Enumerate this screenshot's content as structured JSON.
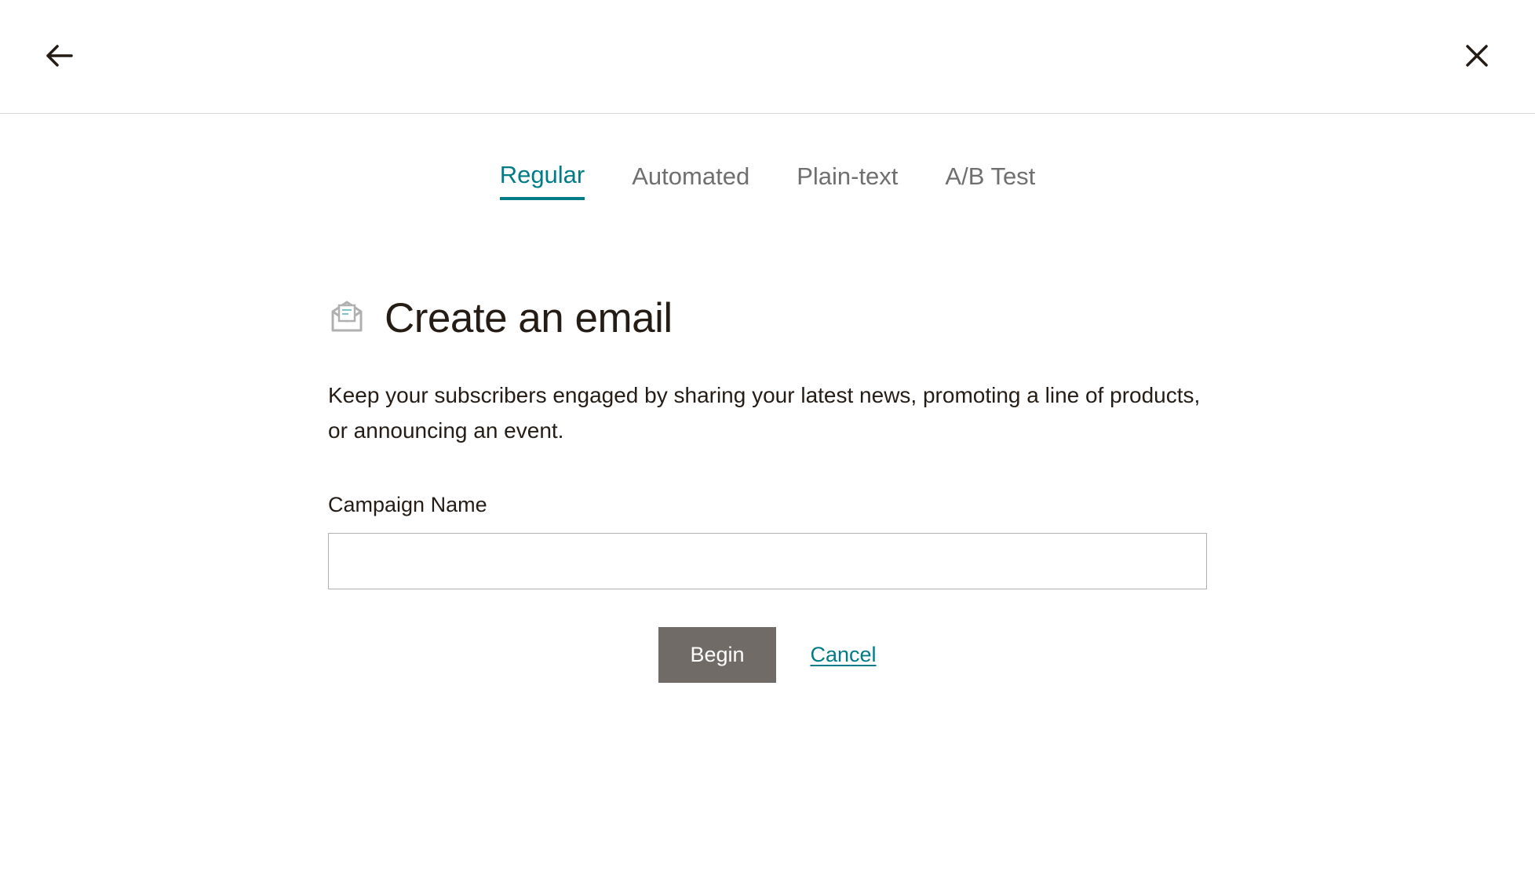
{
  "header": {
    "back_icon": "back-arrow",
    "close_icon": "close-x"
  },
  "tabs": [
    {
      "label": "Regular",
      "active": true
    },
    {
      "label": "Automated",
      "active": false
    },
    {
      "label": "Plain-text",
      "active": false
    },
    {
      "label": "A/B Test",
      "active": false
    }
  ],
  "main": {
    "icon": "email-envelope",
    "title": "Create an email",
    "description": "Keep your subscribers engaged by sharing your latest news, promoting a line of products, or announcing an event.",
    "field_label": "Campaign Name",
    "field_value": "",
    "begin_label": "Begin",
    "cancel_label": "Cancel"
  },
  "colors": {
    "accent": "#007c89",
    "text": "#241c15",
    "muted": "#6f6f6f",
    "button_bg": "#716b67"
  }
}
